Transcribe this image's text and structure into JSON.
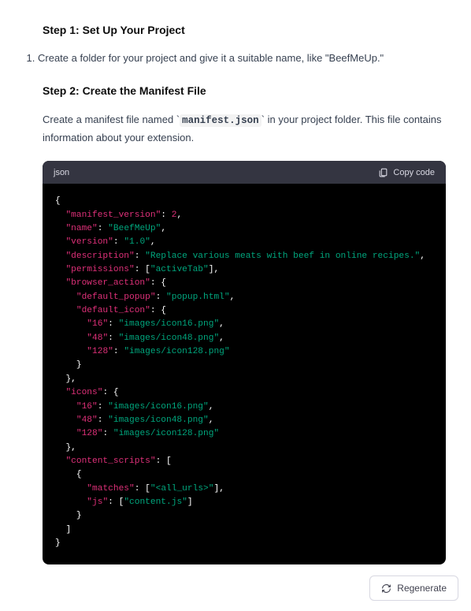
{
  "step1": {
    "heading": "Step 1: Set Up Your Project",
    "item1": "Create a folder for your project and give it a suitable name, like \"BeefMeUp.\""
  },
  "step2": {
    "heading": "Step 2: Create the Manifest File",
    "para_pre": "Create a manifest file named ",
    "para_code": "manifest.json",
    "para_post": " in your project folder. This file contains information about your extension."
  },
  "code": {
    "lang": "json",
    "copy_label": "Copy code",
    "json": {
      "manifest_version": 2,
      "name": "BeefMeUp",
      "version": "1.0",
      "description": "Replace various meats with beef in online recipes.",
      "permissions": [
        "activeTab"
      ],
      "browser_action": {
        "default_popup": "popup.html",
        "default_icon": {
          "16": "images/icon16.png",
          "48": "images/icon48.png",
          "128": "images/icon128.png"
        }
      },
      "icons": {
        "16": "images/icon16.png",
        "48": "images/icon48.png",
        "128": "images/icon128.png"
      },
      "content_scripts": [
        {
          "matches": [
            "<all_urls>"
          ],
          "js": [
            "content.js"
          ]
        }
      ]
    }
  },
  "regen_label": "Regenerate"
}
